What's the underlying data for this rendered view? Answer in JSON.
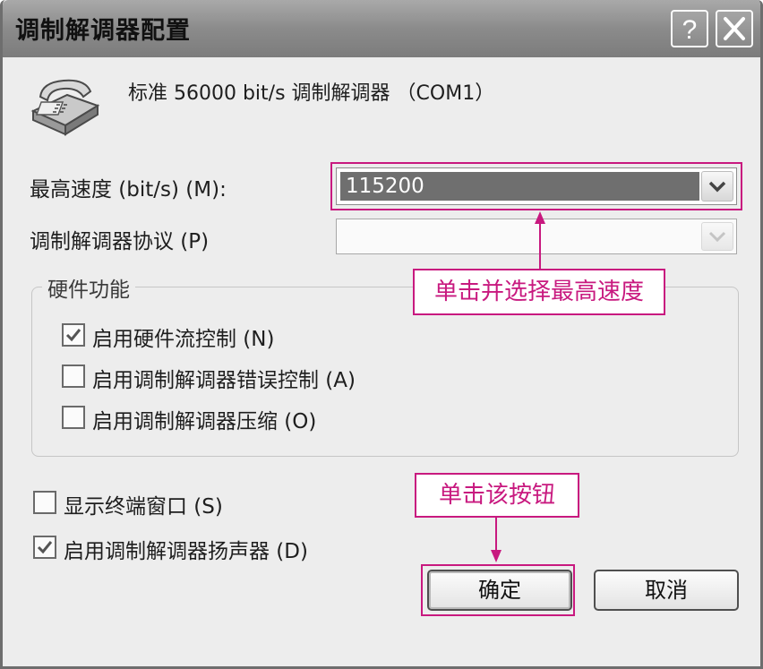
{
  "window": {
    "title": "调制解调器配置",
    "help_glyph": "?",
    "close_glyph": "X",
    "icons": {
      "help": "help-icon",
      "close": "close-icon",
      "modem": "telephone-modem-icon"
    }
  },
  "modem": {
    "name": "标准 56000  bit/s 调制解调器 （COM1）"
  },
  "max_speed": {
    "label": "最高速度 (bit/s) (M):",
    "value": "115200"
  },
  "protocol": {
    "label": "调制解调器协议 (P)",
    "value": ""
  },
  "hardware": {
    "title": "硬件功能",
    "options": [
      {
        "label": "启用硬件流控制 (N)",
        "checked": true
      },
      {
        "label": "启用调制解调器错误控制 (A)",
        "checked": false
      },
      {
        "label": "启用调制解调器压缩 (O)",
        "checked": false
      }
    ]
  },
  "show_terminal": {
    "label": "显示终端窗口 (S)",
    "checked": false
  },
  "speaker": {
    "label": "启用调制解调器扬声器 (D)",
    "checked": true
  },
  "buttons": {
    "ok": "确定",
    "cancel": "取消"
  },
  "annotations": {
    "select_speed": "单击并选择最高速度",
    "click_button": "单击该按钮",
    "color": "#c8197f"
  }
}
